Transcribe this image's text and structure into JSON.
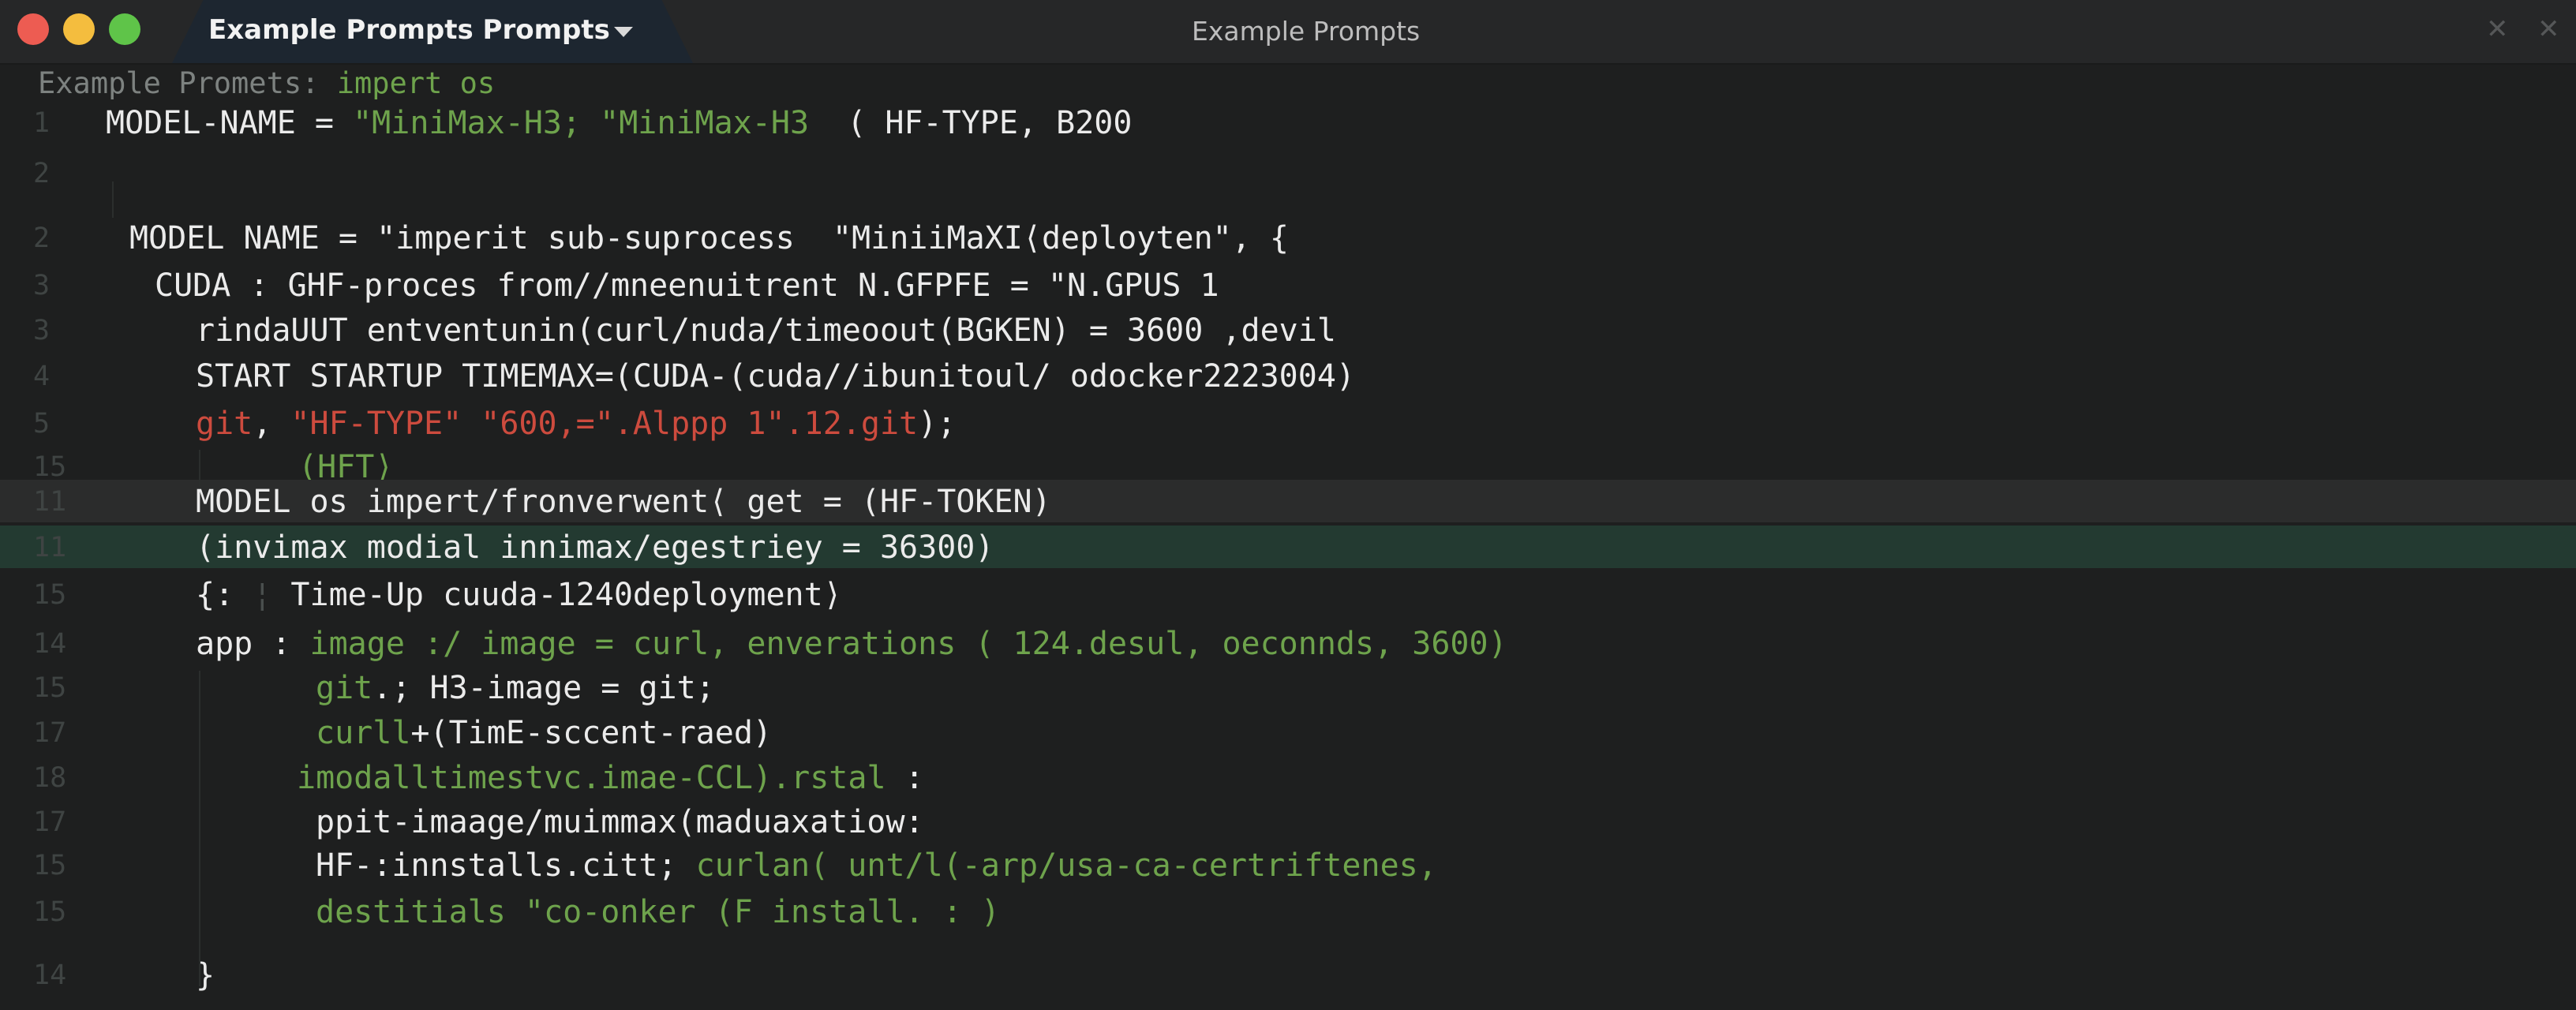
{
  "window": {
    "tab_title": "Example Prompts Prompts",
    "title": "Example Prompts",
    "close_glyph": "✕"
  },
  "header": {
    "prefix": "Example Promets: ",
    "code": "impert os"
  },
  "colors": {
    "titlebar": "#262728",
    "tab_active": "#1d2630",
    "editor_bg": "#1e1f1f",
    "current_line": "#2b2c2c",
    "highlight_line": "#233a31",
    "green": "#6ea34c",
    "red": "#cd4b3e",
    "line_number": "#3f4443",
    "traffic_red": "#ed5c52",
    "traffic_yellow": "#f4bd3e",
    "traffic_green": "#5fc449"
  },
  "lines": [
    {
      "num": "1",
      "highlight": "none",
      "segments": [
        {
          "text": "MODEL-NAME = ",
          "color": "white"
        },
        {
          "text": "\"MiniMax-H3; \"MiniMax-H3",
          "color": "green"
        },
        {
          "text": "  ( HF-TYPE, B200",
          "color": "white"
        }
      ]
    },
    {
      "num": "2",
      "highlight": "none",
      "segments": []
    },
    {
      "num": "2",
      "highlight": "none",
      "segments": [
        {
          "text": "MODEL NAME = \"imperit sub-suprocess  \"MiniiMaXI⟨deployten\", {",
          "color": "white"
        }
      ]
    },
    {
      "num": "3",
      "highlight": "none",
      "segments": [
        {
          "text": "CUDA : GHF-proces from//mneenuitrent N.GFPFE = \"N.GPUS 1",
          "color": "white"
        }
      ]
    },
    {
      "num": "3",
      "highlight": "none",
      "segments": [
        {
          "text": "rindaUUT entventunin(curl/nuda/timeoout(BGKEN) = 3600 ,devil",
          "color": "white"
        }
      ]
    },
    {
      "num": "4",
      "highlight": "none",
      "segments": [
        {
          "text": "START STARTUP TIMEMAX=(CUDA-(cuda//ibunitoul/ odocker2223004)",
          "color": "white"
        }
      ]
    },
    {
      "num": "5",
      "highlight": "none",
      "segments": [
        {
          "text": "git",
          "color": "red"
        },
        {
          "text": ", ",
          "color": "white"
        },
        {
          "text": "\"HF-TYPE\" \"600,=\".Alppp 1\".12.git",
          "color": "red"
        },
        {
          "text": ");",
          "color": "white"
        }
      ]
    },
    {
      "num": "15",
      "highlight": "none",
      "segments": [
        {
          "text": "(HFT⟩",
          "color": "green"
        }
      ]
    },
    {
      "num": "11",
      "highlight": "current",
      "segments": [
        {
          "text": "MODEL os impert/fronverwent⟨ get = (HF-TOKEN)",
          "color": "white"
        }
      ]
    },
    {
      "num": "11",
      "highlight": "selected",
      "segments": [
        {
          "text": "(invimax modial innimax/egestriey = 36300)",
          "color": "white"
        }
      ]
    },
    {
      "num": "15",
      "highlight": "none",
      "segments": [
        {
          "text": "{: ",
          "color": "white"
        },
        {
          "text": "¦",
          "color": "dim"
        },
        {
          "text": " Time-Up cuuda-1240deployment⟩",
          "color": "white"
        }
      ]
    },
    {
      "num": "14",
      "highlight": "none",
      "segments": [
        {
          "text": "app : ",
          "color": "white"
        },
        {
          "text": "image :/ image = curl, enverations ( 124.desul, oeconnds, 3600)",
          "color": "green"
        }
      ]
    },
    {
      "num": "15",
      "highlight": "none",
      "segments": [
        {
          "text": "git",
          "color": "green"
        },
        {
          "text": ".; H3-image = git;",
          "color": "white"
        }
      ]
    },
    {
      "num": "17",
      "highlight": "none",
      "segments": [
        {
          "text": "curll",
          "color": "green"
        },
        {
          "text": "+(TimE-sccent-raed)",
          "color": "white"
        }
      ]
    },
    {
      "num": "18",
      "highlight": "none",
      "segments": [
        {
          "text": "imodalltimestvc.imae-CCL).rstal",
          "color": "green"
        },
        {
          "text": " :",
          "color": "white"
        }
      ]
    },
    {
      "num": "17",
      "highlight": "none",
      "segments": [
        {
          "text": "ppit-imaage/muimmax(maduaxatiow:",
          "color": "white"
        }
      ]
    },
    {
      "num": "15",
      "highlight": "none",
      "segments": [
        {
          "text": "HF-:innstalls.citt; ",
          "color": "white"
        },
        {
          "text": "curlan( unt/l(-arp/usa-ca-certriftenes,",
          "color": "green"
        },
        {
          "text": "",
          "color": "white"
        }
      ]
    },
    {
      "num": "15",
      "highlight": "none",
      "segments": [
        {
          "text": "destitials \"co-onker (F install. : )",
          "color": "green"
        }
      ]
    },
    {
      "num": "14",
      "highlight": "none",
      "segments": [
        {
          "text": "}",
          "color": "white"
        }
      ]
    }
  ]
}
